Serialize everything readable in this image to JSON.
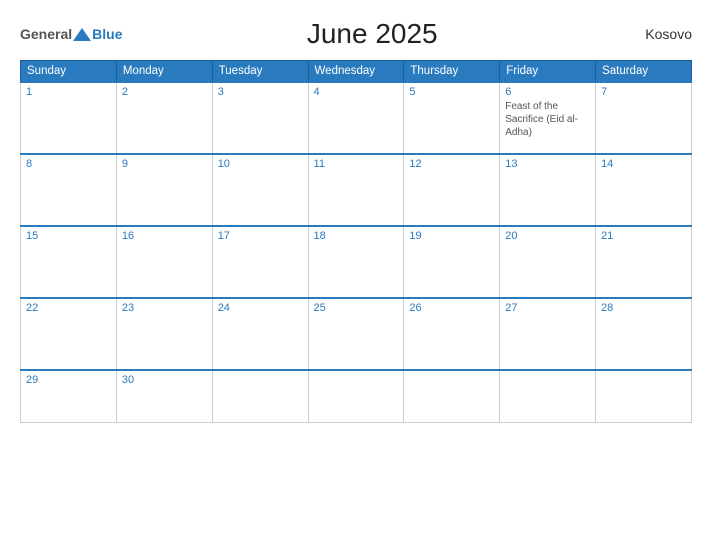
{
  "logo": {
    "general": "General",
    "blue": "Blue"
  },
  "title": "June 2025",
  "country": "Kosovo",
  "days_header": [
    "Sunday",
    "Monday",
    "Tuesday",
    "Wednesday",
    "Thursday",
    "Friday",
    "Saturday"
  ],
  "weeks": [
    {
      "days": [
        {
          "num": "1",
          "holiday": ""
        },
        {
          "num": "2",
          "holiday": ""
        },
        {
          "num": "3",
          "holiday": ""
        },
        {
          "num": "4",
          "holiday": ""
        },
        {
          "num": "5",
          "holiday": ""
        },
        {
          "num": "6",
          "holiday": "Feast of the Sacrifice (Eid al-Adha)"
        },
        {
          "num": "7",
          "holiday": ""
        }
      ]
    },
    {
      "days": [
        {
          "num": "8",
          "holiday": ""
        },
        {
          "num": "9",
          "holiday": ""
        },
        {
          "num": "10",
          "holiday": ""
        },
        {
          "num": "11",
          "holiday": ""
        },
        {
          "num": "12",
          "holiday": ""
        },
        {
          "num": "13",
          "holiday": ""
        },
        {
          "num": "14",
          "holiday": ""
        }
      ]
    },
    {
      "days": [
        {
          "num": "15",
          "holiday": ""
        },
        {
          "num": "16",
          "holiday": ""
        },
        {
          "num": "17",
          "holiday": ""
        },
        {
          "num": "18",
          "holiday": ""
        },
        {
          "num": "19",
          "holiday": ""
        },
        {
          "num": "20",
          "holiday": ""
        },
        {
          "num": "21",
          "holiday": ""
        }
      ]
    },
    {
      "days": [
        {
          "num": "22",
          "holiday": ""
        },
        {
          "num": "23",
          "holiday": ""
        },
        {
          "num": "24",
          "holiday": ""
        },
        {
          "num": "25",
          "holiday": ""
        },
        {
          "num": "26",
          "holiday": ""
        },
        {
          "num": "27",
          "holiday": ""
        },
        {
          "num": "28",
          "holiday": ""
        }
      ]
    },
    {
      "days": [
        {
          "num": "29",
          "holiday": ""
        },
        {
          "num": "30",
          "holiday": ""
        },
        {
          "num": "",
          "holiday": ""
        },
        {
          "num": "",
          "holiday": ""
        },
        {
          "num": "",
          "holiday": ""
        },
        {
          "num": "",
          "holiday": ""
        },
        {
          "num": "",
          "holiday": ""
        }
      ]
    }
  ]
}
